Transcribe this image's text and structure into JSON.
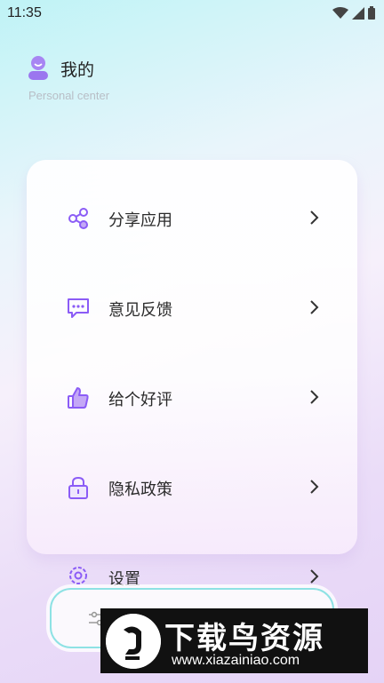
{
  "status_bar": {
    "time": "11:35",
    "icons": [
      "wifi-icon",
      "signal-icon",
      "battery-icon"
    ]
  },
  "header": {
    "title": "我的",
    "subtitle": "Personal center",
    "avatar_icon": "user-avatar-icon"
  },
  "menu": {
    "items": [
      {
        "label": "分享应用",
        "icon": "share-icon"
      },
      {
        "label": "意见反馈",
        "icon": "feedback-chat-icon"
      },
      {
        "label": "给个好评",
        "icon": "thumbs-up-icon"
      },
      {
        "label": "隐私政策",
        "icon": "lock-icon"
      },
      {
        "label": "设置",
        "icon": "gear-icon"
      }
    ]
  },
  "bottom_bar": {
    "icon": "sliders-icon"
  },
  "watermark": {
    "title": "下载鸟资源",
    "url": "www.xiazainiao.com"
  },
  "colors": {
    "accent": "#8b5cf6",
    "accent_light": "#c4a8f6",
    "text": "#2a2a2a",
    "subtitle": "#b8bec6"
  }
}
